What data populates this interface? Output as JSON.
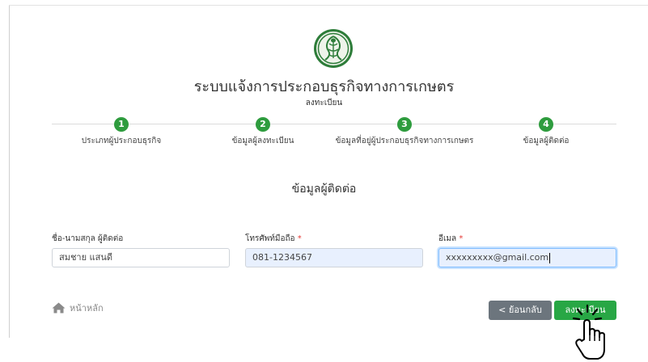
{
  "header": {
    "title": "ระบบแจ้งการประกอบธุรกิจทางการเกษตร",
    "subtitle": "ลงทะเบียน"
  },
  "steps": [
    {
      "number": "1",
      "label": "ประเภทผู้ประกอบธุรกิจ"
    },
    {
      "number": "2",
      "label": "ข้อมูลผู้ลงทะเบียน"
    },
    {
      "number": "3",
      "label": "ข้อมูลที่อยู่ผู้ประกอบธุรกิจทางการเกษตร"
    },
    {
      "number": "4",
      "label": "ข้อมูลผู้ติดต่อ"
    }
  ],
  "section": {
    "title": "ข้อมูลผู้ติดต่อ"
  },
  "form": {
    "name": {
      "label": "ชื่อ-นามสกุล ผู้ติดต่อ",
      "value": "สมชาย แสนดี"
    },
    "phone": {
      "label": "โทรศัพท์มือถือ",
      "required_mark": "*",
      "value": "081-1234567"
    },
    "email": {
      "label": "อีเมล",
      "required_mark": "*",
      "value": "xxxxxxxxx@gmail.com"
    }
  },
  "footer": {
    "home_label": "หน้าหลัก",
    "back_label": "< ย้อนกลับ",
    "next_label": "ลงทะเบียน"
  },
  "colors": {
    "step_green": "#2e9c3e",
    "next_button": "#28a745",
    "back_button": "#6c757d",
    "required": "#e53935"
  },
  "icons": {
    "logo": "ministry-seal-logo",
    "home": "home-icon",
    "cursor": "hand-pointer-cursor"
  }
}
